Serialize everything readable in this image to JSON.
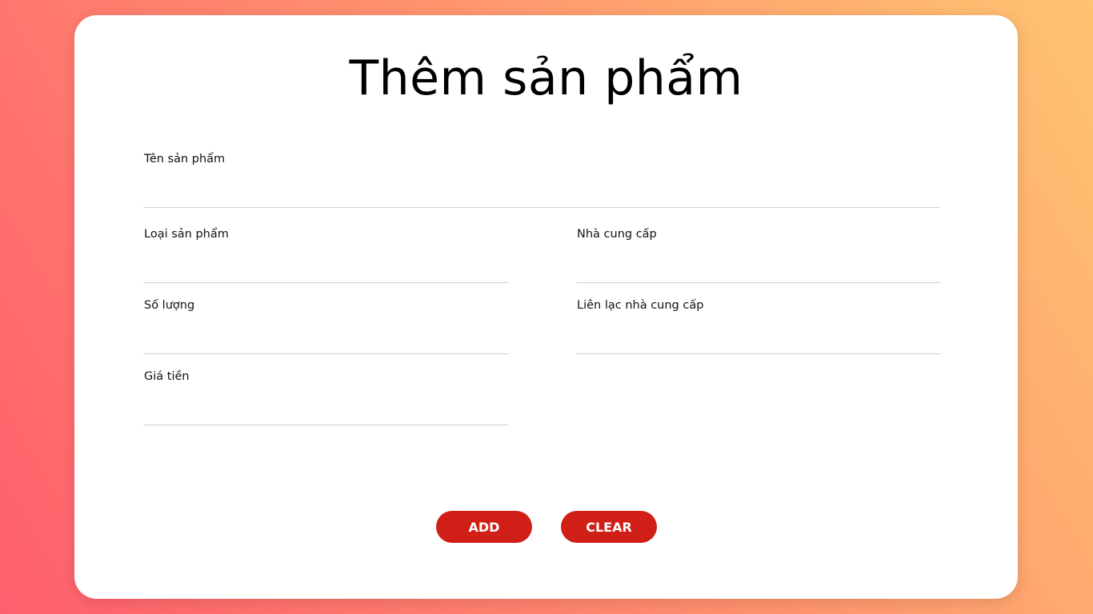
{
  "form": {
    "title": "Thêm sản phẩm",
    "fields": {
      "product_name": {
        "label": "Tên sản phẩm",
        "value": ""
      },
      "product_type": {
        "label": "Loại sản phẩm",
        "value": ""
      },
      "supplier": {
        "label": "Nhà cung cấp",
        "value": ""
      },
      "quantity": {
        "label": "Số lượng",
        "value": ""
      },
      "supplier_contact": {
        "label": "Liên lạc nhà cung cấp",
        "value": ""
      },
      "price": {
        "label": "Giá tiền",
        "value": ""
      }
    },
    "buttons": {
      "add_label": "ADD",
      "clear_label": "CLEAR"
    }
  },
  "colors": {
    "button_bg": "#d01f17",
    "gradient_start": "#ff5f6d",
    "gradient_end": "#ffc371"
  }
}
